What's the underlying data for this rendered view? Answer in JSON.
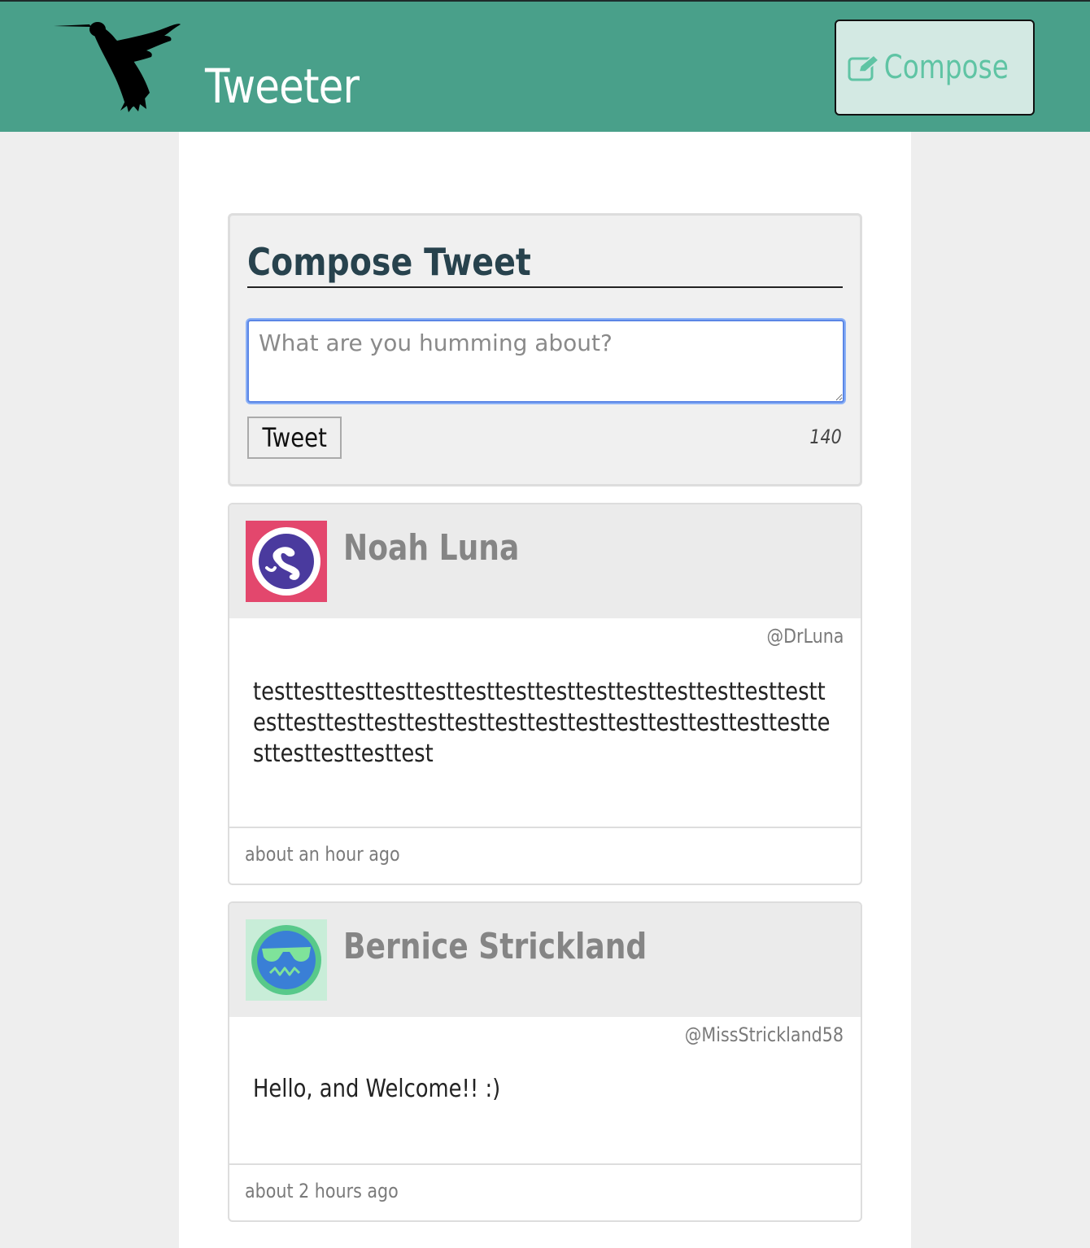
{
  "navbar": {
    "logo_icon": "hummingbird-icon",
    "brand": "Tweeter",
    "compose_label": "Compose",
    "compose_icon": "edit-icon"
  },
  "compose": {
    "title": "Compose Tweet",
    "placeholder": "What are you humming about?",
    "submit_label": "Tweet",
    "counter": "140"
  },
  "tweets": [
    {
      "name": "Noah Luna",
      "handle": "@DrLuna",
      "avatar_icon": "mustache-avatar-icon",
      "avatar_colors": {
        "background": "#e3476d",
        "ring": "#ffffff",
        "fill": "#4a3a9e"
      },
      "body": "testtesttesttesttesttesttesttesttesttesttesttesttesttesttesttesttesttesttesttesttesttesttesttesttesttesttesttesttesttesttesttesttest",
      "time": "about an hour ago"
    },
    {
      "name": "Bernice Strickland",
      "handle": "@MissStrickland58",
      "avatar_icon": "sunglasses-avatar-icon",
      "avatar_colors": {
        "background": "#c8edd8",
        "ring": "#58c98a",
        "fill": "#3a7fd6"
      },
      "body": "Hello, and Welcome!! :)",
      "time": "about 2 hours ago"
    }
  ],
  "colors": {
    "accent": "#49a08a",
    "page_background": "#eeeeee",
    "compose_button_bg": "#d3e9e3",
    "compose_button_text": "#5fc4a4",
    "heading": "#27424d"
  }
}
